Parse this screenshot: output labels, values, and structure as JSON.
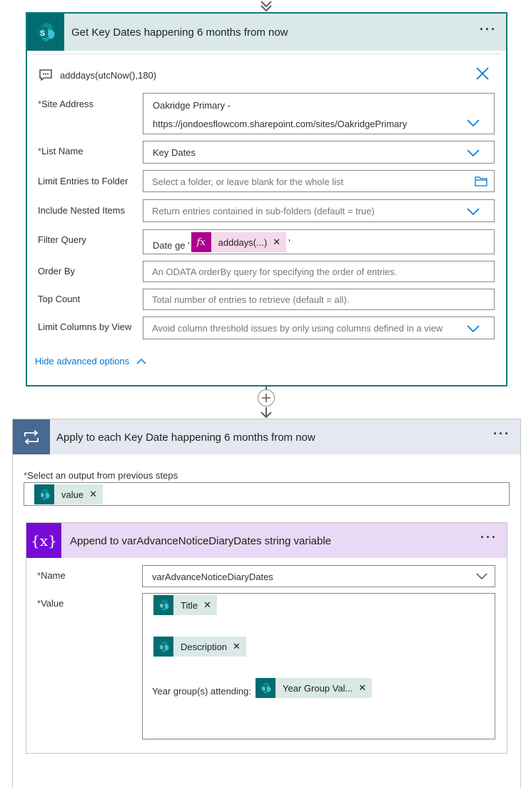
{
  "action1": {
    "title": "Get Key Dates happening 6 months from now",
    "more_label": "···",
    "comment": "adddays(utcNow(),180)",
    "fields": {
      "site_address": {
        "label": "Site Address",
        "required": "*",
        "value_line1": "Oakridge Primary -",
        "value_line2": "https://jondoesflowcom.sharepoint.com/sites/OakridgePrimary"
      },
      "list_name": {
        "label": "List Name",
        "required": "*",
        "value": "Key Dates"
      },
      "limit_folder": {
        "label": "Limit Entries to Folder",
        "placeholder": "Select a folder, or leave blank for the whole list"
      },
      "nested": {
        "label": "Include Nested Items",
        "placeholder": "Return entries contained in sub-folders (default = true)"
      },
      "filter": {
        "label": "Filter Query",
        "prefix": "Date ge '",
        "token": "adddays(...)",
        "suffix": "'"
      },
      "order_by": {
        "label": "Order By",
        "placeholder": "An ODATA orderBy query for specifying the order of entries."
      },
      "top_count": {
        "label": "Top Count",
        "placeholder": "Total number of entries to retrieve (default = all)."
      },
      "limit_view": {
        "label": "Limit Columns by View",
        "placeholder": "Avoid column threshold issues by only using columns defined in a view"
      }
    },
    "hide_advanced": "Hide advanced options"
  },
  "apply_each": {
    "title": "Apply to each Key Date happening 6 months from now",
    "more_label": "···",
    "output_label": "Select an output from previous steps",
    "required": "*",
    "output_token": "value"
  },
  "append_var": {
    "title": "Append to varAdvanceNoticeDiaryDates string variable",
    "more_label": "···",
    "icon_text": "{x}",
    "name": {
      "label": "Name",
      "required": "*",
      "value": "varAdvanceNoticeDiaryDates"
    },
    "value": {
      "label": "Value",
      "required": "*",
      "token_title": "Title",
      "token_description": "Description",
      "year_text": "Year group(s) attending:",
      "token_year": "Year Group Val..."
    }
  },
  "icons": {
    "sharepoint": "sharepoint-icon",
    "comment": "comment-icon",
    "close": "close-icon",
    "chevron": "chevron-down-icon",
    "folder": "folder-icon",
    "loop": "loop-icon",
    "plus": "plus-icon"
  },
  "colors": {
    "sharepoint": "#036c70",
    "sharepoint_header": "#dae9e8",
    "loop": "#486991",
    "loop_header": "#e4e8f0",
    "variable": "#770bd6",
    "variable_header": "#e9d9f4",
    "link": "#0078d4",
    "expression": "#ad008c",
    "required": "#a4262c"
  }
}
